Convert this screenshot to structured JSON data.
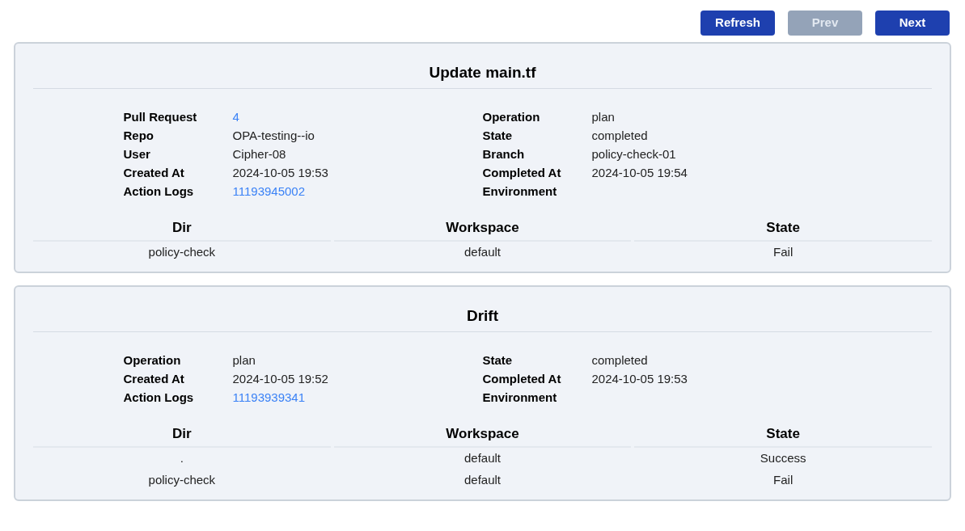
{
  "toolbar": {
    "buttons": [
      {
        "label": "Refresh",
        "disabled": false
      },
      {
        "label": "Prev",
        "disabled": true
      },
      {
        "label": "Next",
        "disabled": false
      }
    ]
  },
  "cards": [
    {
      "title": "Update main.tf",
      "fields": [
        {
          "label": "Pull Request",
          "value": "4",
          "kind": "link"
        },
        {
          "label": "Repo",
          "value": "OPA-testing--io",
          "kind": "text"
        },
        {
          "label": "User",
          "value": "Cipher-08",
          "kind": "text"
        },
        {
          "label": "Created At",
          "value": "2024-10-05 19:53",
          "kind": "text"
        },
        {
          "label": "Action Logs",
          "value": "11193945002",
          "kind": "link"
        },
        {
          "label": "Operation",
          "value": "plan",
          "kind": "text"
        },
        {
          "label": "State",
          "value": "completed",
          "kind": "text"
        },
        {
          "label": "Branch",
          "value": "policy-check-01",
          "kind": "text"
        },
        {
          "label": "Completed At",
          "value": "2024-10-05 19:54",
          "kind": "text"
        },
        {
          "label": "Environment"
        }
      ],
      "table": {
        "columns": [
          "Dir",
          "Workspace",
          "State"
        ],
        "rows": [
          [
            "policy-check",
            "default",
            "Fail"
          ]
        ]
      }
    },
    {
      "title": "Drift",
      "fields": [
        {
          "label": "Operation",
          "value": "plan",
          "kind": "text"
        },
        {
          "label": "Created At",
          "value": "2024-10-05 19:52",
          "kind": "text"
        },
        {
          "label": "Action Logs",
          "value": "11193939341",
          "kind": "link"
        },
        {
          "label": "State",
          "value": "completed",
          "kind": "text"
        },
        {
          "label": "Completed At",
          "value": "2024-10-05 19:53",
          "kind": "text"
        },
        {
          "label": "Environment"
        }
      ],
      "table": {
        "columns": [
          "Dir",
          "Workspace",
          "State"
        ],
        "rows": [
          [
            ".",
            "default",
            "Success"
          ],
          [
            "policy-check",
            "default",
            "Fail"
          ]
        ]
      }
    }
  ]
}
